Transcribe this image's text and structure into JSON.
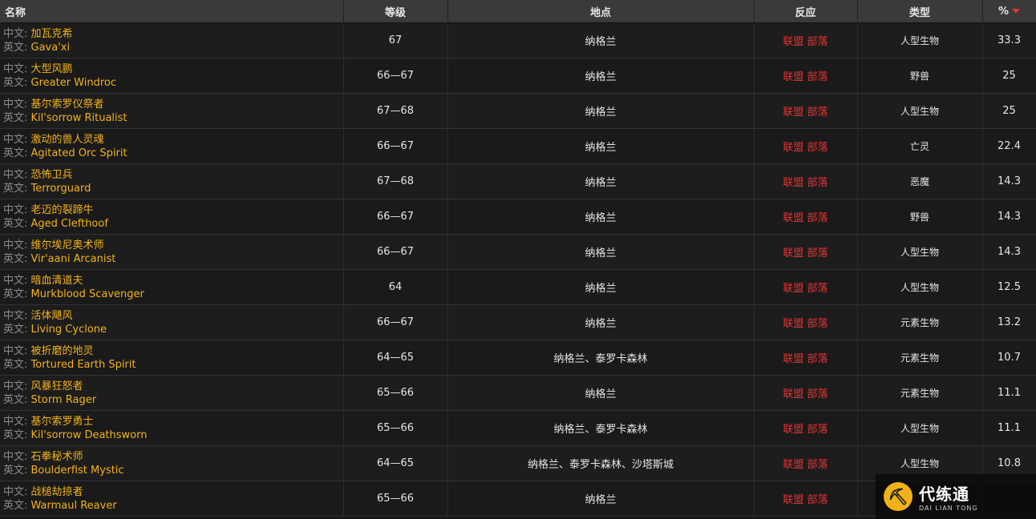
{
  "headers": {
    "name": "名称",
    "level": "等级",
    "location": "地点",
    "reaction": "反应",
    "type": "类型",
    "pct": "%"
  },
  "labels": {
    "cn": "中文: ",
    "en": "英文: "
  },
  "rows": [
    {
      "cn": "加瓦克希",
      "en": "Gava'xi",
      "level": "67",
      "location": "纳格兰",
      "reaction": "联盟 部落",
      "type": "人型生物",
      "pct": "33.3"
    },
    {
      "cn": "大型风鹏",
      "en": "Greater Windroc",
      "level": "66—67",
      "location": "纳格兰",
      "reaction": "联盟 部落",
      "type": "野兽",
      "pct": "25"
    },
    {
      "cn": "基尔索罗仪祭者",
      "en": "Kil'sorrow Ritualist",
      "level": "67—68",
      "location": "纳格兰",
      "reaction": "联盟 部落",
      "type": "人型生物",
      "pct": "25"
    },
    {
      "cn": "激动的兽人灵魂",
      "en": "Agitated Orc Spirit",
      "level": "66—67",
      "location": "纳格兰",
      "reaction": "联盟 部落",
      "type": "亡灵",
      "pct": "22.4"
    },
    {
      "cn": "恐怖卫兵",
      "en": "Terrorguard",
      "level": "67—68",
      "location": "纳格兰",
      "reaction": "联盟 部落",
      "type": "恶魔",
      "pct": "14.3"
    },
    {
      "cn": "老迈的裂蹄牛",
      "en": "Aged Clefthoof",
      "level": "66—67",
      "location": "纳格兰",
      "reaction": "联盟 部落",
      "type": "野兽",
      "pct": "14.3"
    },
    {
      "cn": "维尔埃尼奥术师",
      "en": "Vir'aani Arcanist",
      "level": "66—67",
      "location": "纳格兰",
      "reaction": "联盟 部落",
      "type": "人型生物",
      "pct": "14.3"
    },
    {
      "cn": "暗血清道夫",
      "en": "Murkblood Scavenger",
      "level": "64",
      "location": "纳格兰",
      "reaction": "联盟 部落",
      "type": "人型生物",
      "pct": "12.5"
    },
    {
      "cn": "活体飓风",
      "en": "Living Cyclone",
      "level": "66—67",
      "location": "纳格兰",
      "reaction": "联盟 部落",
      "type": "元素生物",
      "pct": "13.2"
    },
    {
      "cn": "被折磨的地灵",
      "en": "Tortured Earth Spirit",
      "level": "64—65",
      "location": "纳格兰、泰罗卡森林",
      "reaction": "联盟 部落",
      "type": "元素生物",
      "pct": "10.7"
    },
    {
      "cn": "风暴狂怒者",
      "en": "Storm Rager",
      "level": "65—66",
      "location": "纳格兰",
      "reaction": "联盟 部落",
      "type": "元素生物",
      "pct": "11.1"
    },
    {
      "cn": "基尔索罗勇士",
      "en": "Kil'sorrow Deathsworn",
      "level": "65—66",
      "location": "纳格兰、泰罗卡森林",
      "reaction": "联盟 部落",
      "type": "人型生物",
      "pct": "11.1"
    },
    {
      "cn": "石拳秘术师",
      "en": "Boulderfist Mystic",
      "level": "64—65",
      "location": "纳格兰、泰罗卡森林、沙塔斯城",
      "reaction": "联盟 部落",
      "type": "人型生物",
      "pct": "10.8"
    },
    {
      "cn": "战槌劫掠者",
      "en": "Warmaul Reaver",
      "level": "65—66",
      "location": "纳格兰",
      "reaction": "联盟 部落",
      "type": "",
      "pct": ""
    }
  ],
  "watermark": {
    "logo": "⛏",
    "main": "代练通",
    "sub": "DAI LIAN TONG"
  }
}
